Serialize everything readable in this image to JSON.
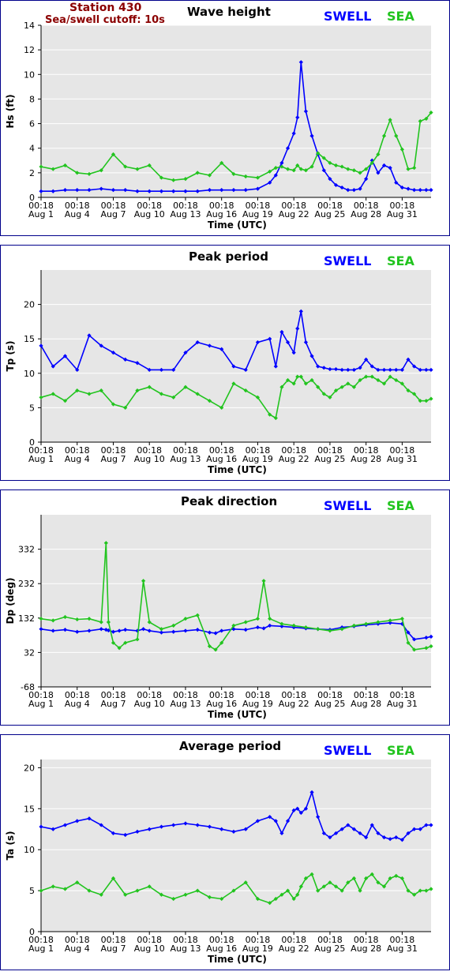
{
  "station": {
    "name": "Station 430",
    "cutoff": "Sea/swell cutoff: 10s"
  },
  "legend": {
    "swell": "SWELL",
    "sea": "SEA"
  },
  "colors": {
    "swell": "#0000ff",
    "sea": "#22c41f",
    "plot_bg": "#e6e6e6",
    "frame": "#00008b",
    "station_text": "#8b0000"
  },
  "x_axis": {
    "label": "Time (UTC)",
    "ticks": [
      {
        "time": "00:18",
        "date": "Aug 1"
      },
      {
        "time": "00:18",
        "date": "Aug 4"
      },
      {
        "time": "00:18",
        "date": "Aug 7"
      },
      {
        "time": "00:18",
        "date": "Aug 10"
      },
      {
        "time": "00:18",
        "date": "Aug 13"
      },
      {
        "time": "00:18",
        "date": "Aug 16"
      },
      {
        "time": "00:18",
        "date": "Aug 19"
      },
      {
        "time": "00:18",
        "date": "Aug 22"
      },
      {
        "time": "00:18",
        "date": "Aug 25"
      },
      {
        "time": "00:18",
        "date": "Aug 28"
      },
      {
        "time": "00:18",
        "date": "Aug 31"
      }
    ]
  },
  "chart_data": [
    {
      "type": "line",
      "title": "Wave height",
      "ylabel": "Hs (ft)",
      "ylim": [
        0,
        14
      ],
      "yticks": [
        0,
        2,
        4,
        6,
        8,
        10,
        12,
        14
      ],
      "xlim": [
        1,
        33.4
      ],
      "grid": "horizontal",
      "x": [
        1,
        2,
        3,
        4,
        5,
        6,
        7,
        8,
        9,
        10,
        11,
        12,
        13,
        14,
        15,
        16,
        17,
        18,
        19,
        20,
        20.5,
        21,
        21.5,
        22,
        22.3,
        22.6,
        23,
        23.5,
        24,
        24.5,
        25,
        25.5,
        26,
        26.5,
        27,
        27.5,
        28,
        28.5,
        29,
        29.5,
        30,
        30.5,
        31,
        31.5,
        32,
        32.5,
        33,
        33.4
      ],
      "series": [
        {
          "name": "SWELL",
          "values": [
            0.5,
            0.5,
            0.6,
            0.6,
            0.6,
            0.7,
            0.6,
            0.6,
            0.5,
            0.5,
            0.5,
            0.5,
            0.5,
            0.5,
            0.6,
            0.6,
            0.6,
            0.6,
            0.7,
            1.2,
            1.8,
            2.8,
            4.0,
            5.2,
            6.5,
            11.0,
            7.0,
            5.0,
            3.5,
            2.2,
            1.5,
            1.0,
            0.8,
            0.6,
            0.6,
            0.7,
            1.5,
            3.0,
            2.0,
            2.6,
            2.4,
            1.2,
            0.8,
            0.7,
            0.6,
            0.6,
            0.6,
            0.6
          ]
        },
        {
          "name": "SEA",
          "values": [
            2.5,
            2.3,
            2.6,
            2.0,
            1.9,
            2.2,
            3.5,
            2.5,
            2.3,
            2.6,
            1.6,
            1.4,
            1.5,
            2.0,
            1.8,
            2.8,
            1.9,
            1.7,
            1.6,
            2.1,
            2.4,
            2.5,
            2.3,
            2.2,
            2.6,
            2.3,
            2.2,
            2.5,
            3.6,
            3.2,
            2.8,
            2.6,
            2.5,
            2.3,
            2.2,
            2.0,
            2.3,
            2.8,
            3.5,
            5.0,
            6.3,
            5.0,
            3.9,
            2.3,
            2.4,
            6.2,
            6.4,
            6.9
          ]
        }
      ]
    },
    {
      "type": "line",
      "title": "Peak period",
      "ylabel": "Tp (s)",
      "ylim": [
        0,
        25
      ],
      "yticks": [
        0,
        5,
        10,
        15,
        20
      ],
      "xlim": [
        1,
        33.4
      ],
      "grid": "horizontal",
      "x": [
        1,
        2,
        3,
        4,
        5,
        6,
        7,
        8,
        9,
        10,
        11,
        12,
        13,
        14,
        15,
        16,
        17,
        18,
        19,
        20,
        20.5,
        21,
        21.5,
        22,
        22.3,
        22.6,
        23,
        23.5,
        24,
        24.5,
        25,
        25.5,
        26,
        26.5,
        27,
        27.5,
        28,
        28.5,
        29,
        29.5,
        30,
        30.5,
        31,
        31.5,
        32,
        32.5,
        33,
        33.4
      ],
      "series": [
        {
          "name": "SWELL",
          "values": [
            14.0,
            11.0,
            12.5,
            10.5,
            15.5,
            14.0,
            13.0,
            12.0,
            11.5,
            10.5,
            10.5,
            10.5,
            13.0,
            14.5,
            14.0,
            13.5,
            11.0,
            10.5,
            14.5,
            15.0,
            11.0,
            16.0,
            14.5,
            13.0,
            16.5,
            19.0,
            14.5,
            12.5,
            11.0,
            10.8,
            10.6,
            10.6,
            10.5,
            10.5,
            10.5,
            10.8,
            12.0,
            11.0,
            10.5,
            10.5,
            10.5,
            10.5,
            10.5,
            12.0,
            11.0,
            10.5,
            10.5,
            10.5
          ]
        },
        {
          "name": "SEA",
          "values": [
            6.5,
            7.0,
            6.0,
            7.5,
            7.0,
            7.5,
            5.5,
            5.0,
            7.5,
            8.0,
            7.0,
            6.5,
            8.0,
            7.0,
            6.0,
            5.0,
            8.5,
            7.5,
            6.5,
            4.0,
            3.5,
            8.0,
            9.0,
            8.5,
            9.5,
            9.5,
            8.5,
            9.0,
            8.0,
            7.0,
            6.5,
            7.5,
            8.0,
            8.5,
            8.0,
            9.0,
            9.5,
            9.5,
            9.0,
            8.5,
            9.5,
            9.0,
            8.5,
            7.5,
            7.0,
            6.0,
            6.0,
            6.3
          ]
        }
      ]
    },
    {
      "type": "line",
      "title": "Peak direction",
      "ylabel": "Dp (deg)",
      "ylim": [
        -68,
        432
      ],
      "yticks": [
        -68,
        32,
        132,
        232,
        332
      ],
      "xlim": [
        1,
        33.4
      ],
      "grid": "horizontal",
      "x": [
        1,
        2,
        3,
        4,
        5,
        6,
        6.4,
        6.6,
        7,
        7.5,
        8,
        9,
        9.5,
        10,
        11,
        12,
        13,
        14,
        15,
        15.5,
        16,
        17,
        18,
        19,
        19.5,
        20,
        21,
        22,
        23,
        24,
        25,
        26,
        27,
        28,
        29,
        30,
        31,
        31.5,
        32,
        33,
        33.4
      ],
      "series": [
        {
          "name": "SWELL",
          "values": [
            100,
            95,
            98,
            92,
            95,
            100,
            98,
            96,
            92,
            95,
            98,
            95,
            100,
            95,
            90,
            92,
            95,
            98,
            90,
            88,
            95,
            100,
            98,
            105,
            102,
            110,
            108,
            105,
            102,
            100,
            98,
            105,
            108,
            112,
            115,
            118,
            115,
            90,
            70,
            75,
            78
          ]
        },
        {
          "name": "SEA",
          "values": [
            130,
            125,
            135,
            128,
            130,
            120,
            350,
            120,
            60,
            45,
            60,
            70,
            240,
            120,
            100,
            110,
            130,
            140,
            50,
            40,
            60,
            110,
            120,
            130,
            240,
            130,
            115,
            110,
            105,
            100,
            95,
            100,
            110,
            115,
            120,
            125,
            130,
            60,
            40,
            45,
            50
          ]
        }
      ]
    },
    {
      "type": "line",
      "title": "Average period",
      "ylabel": "Ta (s)",
      "ylim": [
        0,
        21
      ],
      "yticks": [
        0,
        5,
        10,
        15,
        20
      ],
      "xlim": [
        1,
        33.4
      ],
      "grid": "horizontal",
      "x": [
        1,
        2,
        3,
        4,
        5,
        6,
        7,
        8,
        9,
        10,
        11,
        12,
        13,
        14,
        15,
        16,
        17,
        18,
        19,
        20,
        20.5,
        21,
        21.5,
        22,
        22.3,
        22.6,
        23,
        23.5,
        24,
        24.5,
        25,
        25.5,
        26,
        26.5,
        27,
        27.5,
        28,
        28.5,
        29,
        29.5,
        30,
        30.5,
        31,
        31.5,
        32,
        32.5,
        33,
        33.4
      ],
      "series": [
        {
          "name": "SEA",
          "values": [
            5.0,
            5.5,
            5.2,
            6.0,
            5.0,
            4.5,
            6.5,
            4.5,
            5.0,
            5.5,
            4.5,
            4.0,
            4.5,
            5.0,
            4.2,
            4.0,
            5.0,
            6.0,
            4.0,
            3.5,
            4.0,
            4.5,
            5.0,
            4.0,
            4.5,
            5.5,
            6.5,
            7.0,
            5.0,
            5.5,
            6.0,
            5.5,
            5.0,
            6.0,
            6.5,
            5.0,
            6.5,
            7.0,
            6.0,
            5.5,
            6.5,
            6.8,
            6.5,
            5.0,
            4.5,
            5.0,
            5.0,
            5.2
          ]
        },
        {
          "name": "SWELL",
          "values": [
            12.8,
            12.5,
            13.0,
            13.5,
            13.8,
            13.0,
            12.0,
            11.8,
            12.2,
            12.5,
            12.8,
            13.0,
            13.2,
            13.0,
            12.8,
            12.5,
            12.2,
            12.5,
            13.5,
            14.0,
            13.5,
            12.0,
            13.5,
            14.8,
            15.0,
            14.5,
            15.0,
            17.0,
            14.0,
            12.0,
            11.5,
            12.0,
            12.5,
            13.0,
            12.5,
            12.0,
            11.5,
            13.0,
            12.0,
            11.5,
            11.3,
            11.5,
            11.2,
            12.0,
            12.5,
            12.5,
            13.0,
            13.0
          ]
        }
      ]
    }
  ]
}
